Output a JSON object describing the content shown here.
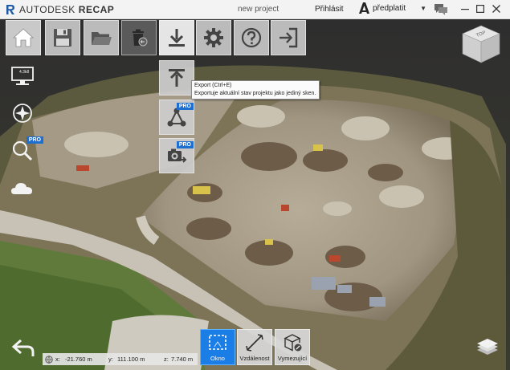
{
  "titlebar": {
    "company": "AUTODESK",
    "product": "RECAP",
    "project_name": "new project",
    "signin": "Přihlásit",
    "subscribe": "předplatit"
  },
  "toolbar": {
    "items": [
      {
        "name": "home",
        "icon": "home-icon"
      },
      {
        "name": "save",
        "icon": "save-icon"
      },
      {
        "name": "open",
        "icon": "folder-icon"
      },
      {
        "name": "delete",
        "icon": "trash-icon"
      },
      {
        "name": "export",
        "icon": "download-icon"
      },
      {
        "name": "settings",
        "icon": "gear-icon"
      },
      {
        "name": "help",
        "icon": "help-icon"
      },
      {
        "name": "exit",
        "icon": "exit-icon"
      }
    ],
    "export_submenu": [
      {
        "name": "upload",
        "icon": "upload-icon",
        "pro": ""
      },
      {
        "name": "share",
        "icon": "share-icon",
        "pro": "PRO"
      },
      {
        "name": "screenshot",
        "icon": "camera-export-icon",
        "pro": "PRO"
      }
    ]
  },
  "tooltip": {
    "title": "Export (Ctrl+E)",
    "description": "Exportuje aktuální stav projektu jako jediný sken."
  },
  "left_tools": {
    "display_badge": "4.3k8",
    "search_pro": "PRO"
  },
  "navcube": {
    "face_label": "TOP"
  },
  "coordinates": {
    "x_label": "x:",
    "x_value": "-21.760    m",
    "y_label": "y:",
    "y_value": "111.100    m",
    "z_label": "z:",
    "z_value": "7.740    m"
  },
  "measure": {
    "window_label": "Okno",
    "distance_label": "Vzdálenost",
    "clip_label": "Vymezující"
  },
  "colors": {
    "accent": "#1a7ee6",
    "pro_badge": "#1f6fd1",
    "titlebar_bg": "#f3f3f3"
  }
}
